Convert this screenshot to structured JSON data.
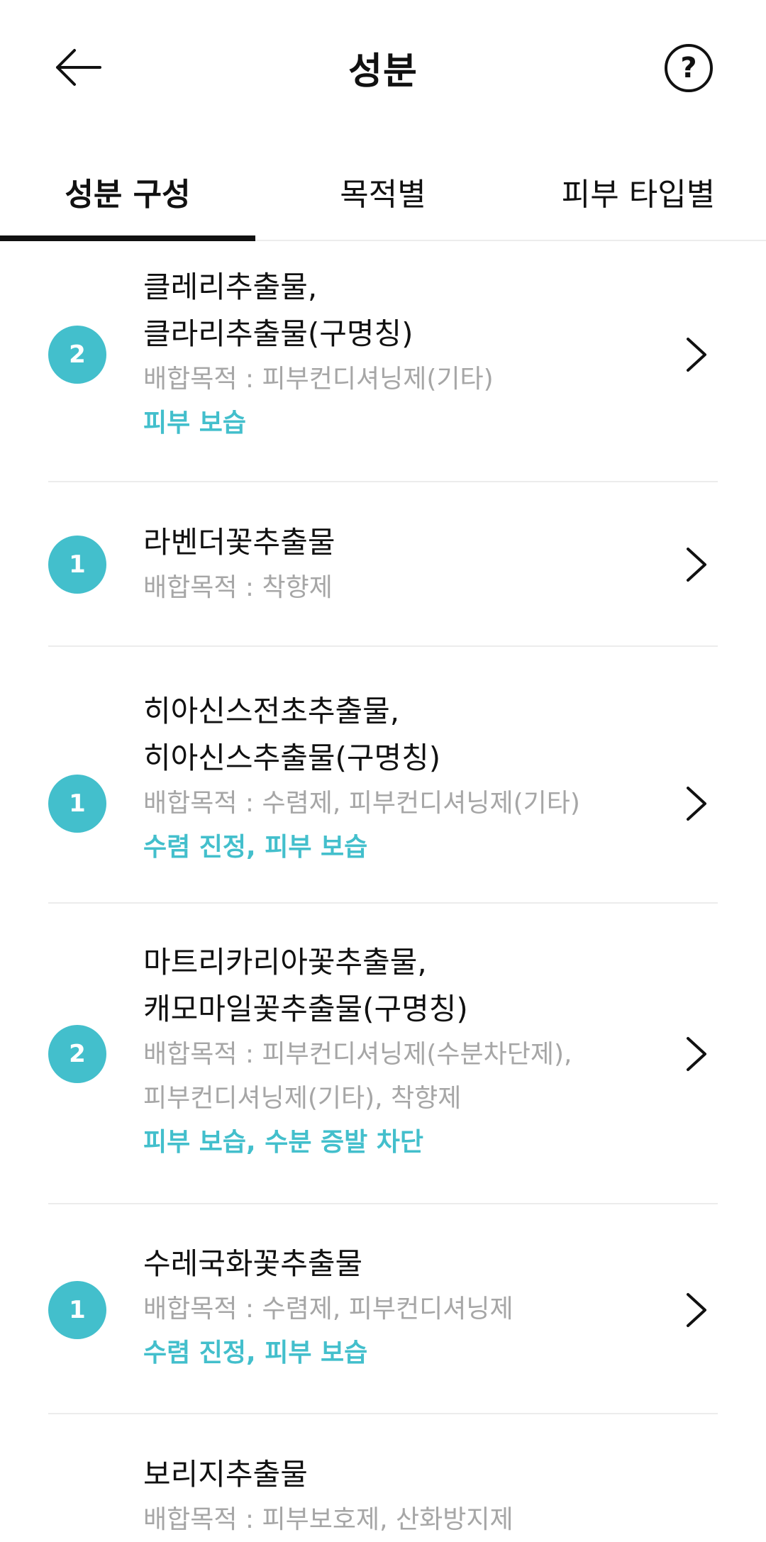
{
  "header": {
    "title": "성분",
    "help_symbol": "?"
  },
  "tabs": [
    {
      "label": "성분 구성",
      "active": true
    },
    {
      "label": "목적별",
      "active": false
    },
    {
      "label": "피부 타입별",
      "active": false
    }
  ],
  "colors": {
    "accent": "#43bfcc",
    "secondary_text": "#a6a6a6",
    "divider": "#ececec"
  },
  "ingredients": [
    {
      "grade": "2",
      "name_lines": [
        "클레리추출물,",
        "클라리추출물(구명칭)"
      ],
      "purpose_lines": [
        "배합목적 : 피부컨디셔닝제(기타)"
      ],
      "effect": "피부 보습"
    },
    {
      "grade": "1",
      "name_lines": [
        "라벤더꽃추출물"
      ],
      "purpose_lines": [
        "배합목적 : 착향제"
      ],
      "effect": ""
    },
    {
      "grade": "1",
      "name_lines": [
        "히아신스전초추출물,",
        "히아신스추출물(구명칭)"
      ],
      "purpose_lines": [
        "배합목적 : 수렴제, 피부컨디셔닝제(기타)"
      ],
      "effect": "수렴 진정, 피부 보습"
    },
    {
      "grade": "2",
      "name_lines": [
        "마트리카리아꽃추출물,",
        "캐모마일꽃추출물(구명칭)"
      ],
      "purpose_lines": [
        "배합목적 : 피부컨디셔닝제(수분차단제),",
        "피부컨디셔닝제(기타), 착향제"
      ],
      "effect": "피부 보습, 수분 증발 차단"
    },
    {
      "grade": "1",
      "name_lines": [
        "수레국화꽃추출물"
      ],
      "purpose_lines": [
        "배합목적 : 수렴제, 피부컨디셔닝제"
      ],
      "effect": "수렴 진정, 피부 보습"
    },
    {
      "grade": "",
      "name_lines": [
        "보리지추출물"
      ],
      "purpose_lines": [
        "배합목적 : 피부보호제, 산화방지제"
      ],
      "effect": ""
    }
  ]
}
